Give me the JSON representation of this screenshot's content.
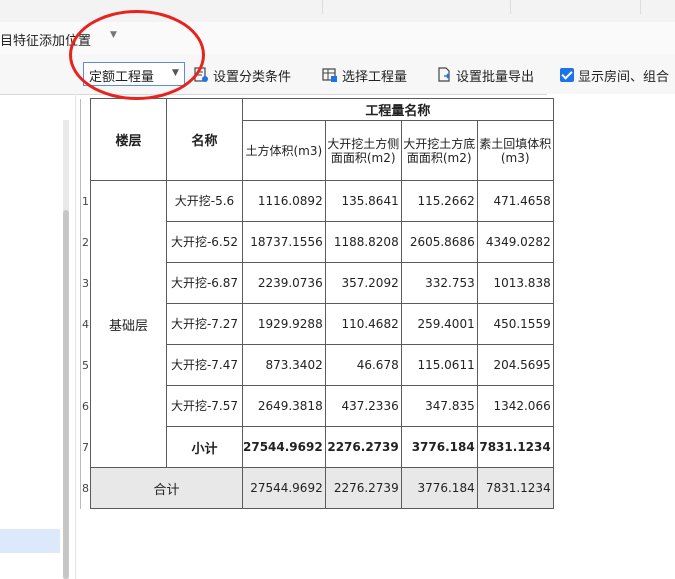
{
  "menu": {
    "field_label": "目特征添加位置"
  },
  "toolbar": {
    "dropdown_value": "定额工程量",
    "btn_set_category": "设置分类条件",
    "btn_select_qty": "选择工程量",
    "btn_batch_export": "设置批量导出",
    "checkbox_label": "显示房间、组合"
  },
  "table": {
    "col_floor": "楼层",
    "col_name": "名称",
    "group_header": "工程量名称",
    "qty_headers": [
      "土方体积(m3)",
      "大开挖土方侧面面积(m2)",
      "大开挖土方底面面积(m2)",
      "素土回填体积(m3)"
    ],
    "floor_value": "基础层",
    "rows": [
      {
        "num": "1",
        "name": "大开挖-5.6",
        "v": [
          "1116.0892",
          "135.8641",
          "115.2662",
          "471.4658"
        ]
      },
      {
        "num": "2",
        "name": "大开挖-6.52",
        "v": [
          "18737.1556",
          "1188.8208",
          "2605.8686",
          "4349.0282"
        ]
      },
      {
        "num": "3",
        "name": "大开挖-6.87",
        "v": [
          "2239.0736",
          "357.2092",
          "332.753",
          "1013.838"
        ]
      },
      {
        "num": "4",
        "name": "大开挖-7.27",
        "v": [
          "1929.9288",
          "110.4682",
          "259.4001",
          "450.1559"
        ]
      },
      {
        "num": "5",
        "name": "大开挖-7.47",
        "v": [
          "873.3402",
          "46.678",
          "115.0611",
          "204.5695"
        ]
      },
      {
        "num": "6",
        "name": "大开挖-7.57",
        "v": [
          "2649.3818",
          "437.2336",
          "347.835",
          "1342.066"
        ]
      }
    ],
    "subtotal": {
      "num": "7",
      "label": "小计",
      "v": [
        "27544.9692",
        "2276.2739",
        "3776.184",
        "7831.1234"
      ]
    },
    "total": {
      "num": "8",
      "label": "合计",
      "v": [
        "27544.9692",
        "2276.2739",
        "3776.184",
        "7831.1234"
      ]
    }
  }
}
